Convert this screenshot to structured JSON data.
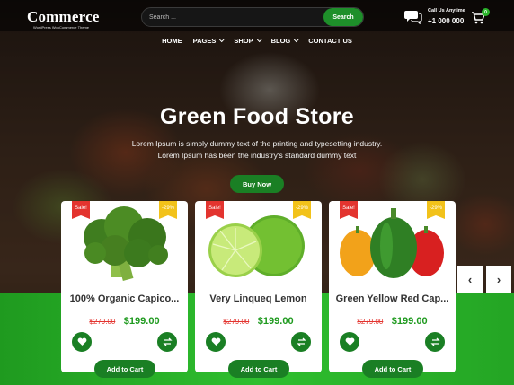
{
  "header": {
    "logo_text": "Commerce",
    "logo_prefix": "Ample",
    "logo_tagline": "WordPress WooCommerce Theme",
    "search_placeholder": "Search ...",
    "search_button": "Search",
    "contact_label": "Call Us Anytime",
    "contact_phone": "+1 000 000",
    "cart_count": "0"
  },
  "nav": {
    "items": [
      {
        "label": "HOME",
        "dropdown": false
      },
      {
        "label": "PAGES",
        "dropdown": true
      },
      {
        "label": "SHOP",
        "dropdown": true
      },
      {
        "label": "BLOG",
        "dropdown": true
      },
      {
        "label": "CONTACT US",
        "dropdown": false
      }
    ]
  },
  "hero": {
    "title": "Green Food Store",
    "desc_line1": "Lorem Ipsum is simply dummy text of the printing and typesetting industry.",
    "desc_line2": "Lorem Ipsum has been the industry's standard dummy text",
    "button": "Buy Now"
  },
  "products": [
    {
      "title": "100% Organic Capico...",
      "old_price": "$279.00",
      "new_price": "$199.00",
      "sale": "Sale!",
      "discount": "-29%",
      "cart_label": "Add to Cart",
      "image": "broccoli"
    },
    {
      "title": "Very Linqueq Lemon",
      "old_price": "$279.00",
      "new_price": "$199.00",
      "sale": "Sale!",
      "discount": "-29%",
      "cart_label": "Add to Cart",
      "image": "lime"
    },
    {
      "title": "Green Yellow Red Cap...",
      "old_price": "$279.00",
      "new_price": "$199.00",
      "sale": "Sale!",
      "discount": "-29%",
      "cart_label": "Add to Cart",
      "image": "peppers"
    }
  ],
  "slider": {
    "prev": "‹",
    "next": "›"
  },
  "colors": {
    "accent": "#1a7f24",
    "band": "#2fbf2f",
    "sale": "#e3342f",
    "discount": "#f2c21a"
  }
}
